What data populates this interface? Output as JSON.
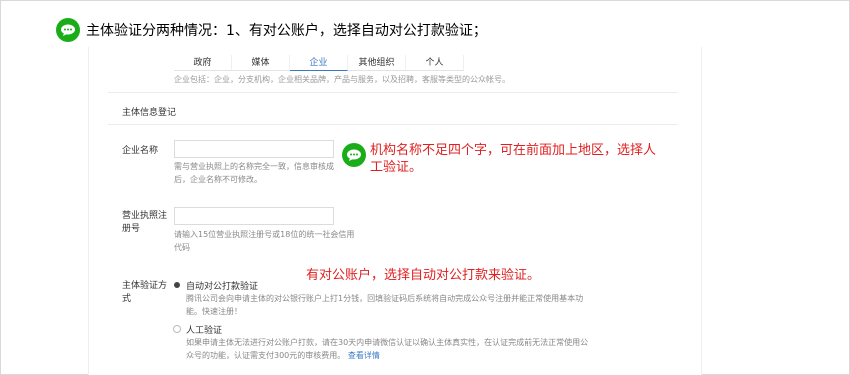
{
  "heading": "主体验证分两种情况：1、有对公账户，选择自动对公打款验证；",
  "tabs": [
    {
      "label": "政府",
      "active": false
    },
    {
      "label": "媒体",
      "active": false
    },
    {
      "label": "企业",
      "active": true
    },
    {
      "label": "其他组织",
      "active": false
    },
    {
      "label": "个人",
      "active": false
    }
  ],
  "tab_description": "企业包括：企业，分支机构，企业相关品牌，产品与服务，以及招聘，客服等类型的公众帐号。",
  "section_title": "主体信息登记",
  "company_name": {
    "label": "企业名称",
    "value": "",
    "hint_line1": "需与营业执照上的名称完全一致，信息审核成",
    "hint_line2": "后，企业名称不可修改。"
  },
  "license": {
    "label_line1": "营业执照注",
    "label_line2": "册号",
    "value": "",
    "hint_line1": "请输入15位营业执照注册号或18位的统一社会信用",
    "hint_line2": "代码"
  },
  "verify_method": {
    "label_line1": "主体验证方",
    "label_line2": "式",
    "options": [
      {
        "title": "自动对公打款验证",
        "selected": true,
        "desc_line1": "腾讯公司会向申请主体的对公银行账户上打1分钱，回填验证码后系统将自动完成公众号注册并能正常使用基本功",
        "desc_line2": "能。快速注册！"
      },
      {
        "title": "人工验证",
        "selected": false,
        "desc_line1": "如果申请主体无法进行对公账户打款，请在30天内申请微信认证以确认主体真实性，在认证完成前无法正常使用公",
        "desc_line2": "众号的功能，认证需支付300元的审核费用。",
        "link": "查看详情"
      }
    ]
  },
  "annotations": {
    "name_note_line1": "机构名称不足四个字，可在前面加上地区，选择人",
    "name_note_line2": "工验证。",
    "account_note": "有对公账户，选择自动对公打款来验证。"
  },
  "colors": {
    "wechat_green": "#1aad19",
    "annotation_red": "#e02020",
    "link_blue": "#3a78c3"
  },
  "icons": {
    "annotation": "wechat-icon"
  }
}
